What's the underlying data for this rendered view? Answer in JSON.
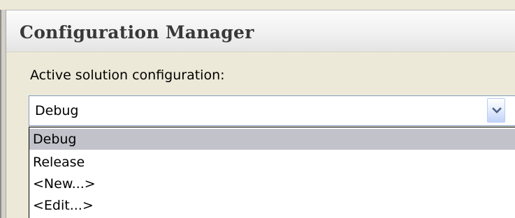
{
  "window": {
    "title": "Configuration Manager"
  },
  "active_config": {
    "label": "Active solution configuration:",
    "value": "Debug",
    "dropdown_icon": "chevron-down-icon"
  },
  "dropdown": {
    "options": [
      {
        "label": "Debug",
        "selected": true
      },
      {
        "label": "Release",
        "selected": false
      },
      {
        "label": "<New...>",
        "selected": false
      },
      {
        "label": "<Edit...>",
        "selected": false
      }
    ]
  },
  "colors": {
    "selected_option_bg": "#c1c2ca",
    "combo_border": "#7f9db9",
    "dialog_bg": "#ece9d8"
  }
}
